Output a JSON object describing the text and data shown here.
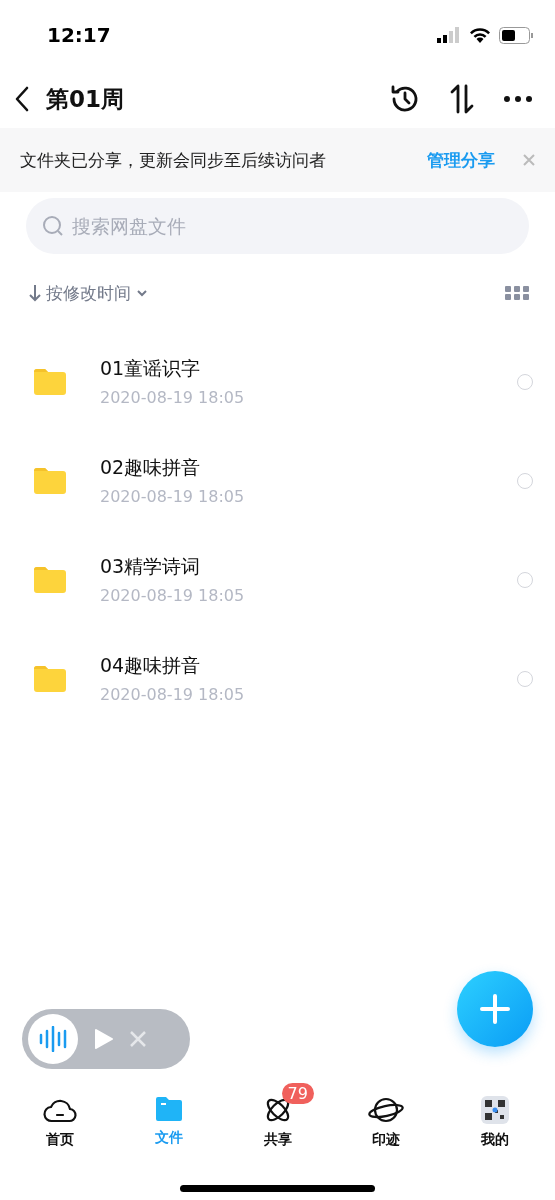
{
  "status_bar": {
    "time": "12:17"
  },
  "header": {
    "title": "第01周"
  },
  "banner": {
    "text": "文件夹已分享，更新会同步至后续访问者",
    "action": "管理分享"
  },
  "search": {
    "placeholder": "搜索网盘文件"
  },
  "sort": {
    "label": "按修改时间"
  },
  "files": [
    {
      "name": "01童谣识字",
      "date": "2020-08-19 18:05",
      "checked": false
    },
    {
      "name": "02趣味拼音",
      "date": "2020-08-19 18:05",
      "checked": false
    },
    {
      "name": "03精学诗词",
      "date": "2020-08-19 18:05",
      "checked": false
    },
    {
      "name": "04趣味拼音",
      "date": "2020-08-19 18:05",
      "checked": false
    }
  ],
  "tabs": [
    {
      "kind": "home",
      "label": "首页",
      "selected": false
    },
    {
      "kind": "files",
      "label": "文件",
      "selected": true
    },
    {
      "kind": "share",
      "label": "共享",
      "selected": false,
      "badge": "79"
    },
    {
      "kind": "planet",
      "label": "印迹",
      "selected": false
    },
    {
      "kind": "me",
      "label": "我的",
      "selected": false
    }
  ]
}
